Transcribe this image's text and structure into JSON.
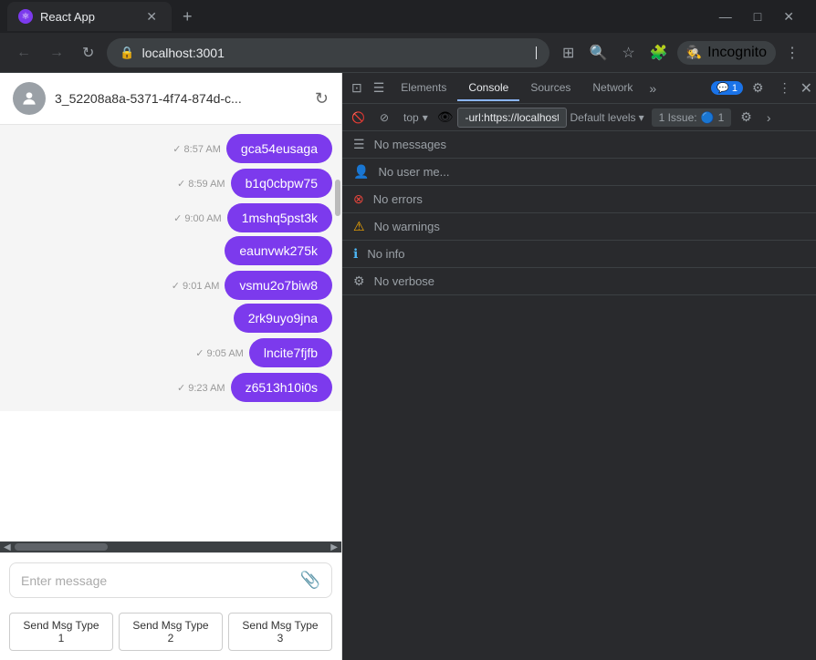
{
  "browser": {
    "tab_title": "React App",
    "address": "localhost:3001",
    "new_tab_icon": "+",
    "nav": {
      "back": "←",
      "forward": "→",
      "reload": "↻"
    },
    "window_controls": {
      "minimize": "—",
      "maximize": "□",
      "close": "✕"
    },
    "incognito_label": "Incognito"
  },
  "app": {
    "header_title": "3_52208a8a-5371-4f74-874d-c...",
    "messages": [
      {
        "time": "8:57 AM",
        "check": true,
        "bubbles": [
          "gca54eusaga"
        ]
      },
      {
        "time": "8:59 AM",
        "check": true,
        "bubbles": [
          "b1q0cbpw75"
        ]
      },
      {
        "time": "9:00 AM",
        "check": true,
        "bubbles": [
          "1mshq5pst3k",
          "eaunvwk275k"
        ]
      },
      {
        "time": "9:01 AM",
        "check": true,
        "bubbles": [
          "vsmu2o7biw8",
          "2rk9uyo9jna"
        ]
      },
      {
        "time": "9:05 AM",
        "check": true,
        "bubbles": [
          "lncite7fjfb"
        ]
      },
      {
        "time": "9:23 AM",
        "check": true,
        "bubbles": [
          "z6513h10i0s"
        ]
      }
    ],
    "input_placeholder": "Enter message",
    "action_buttons": [
      "Send Msg Type 1",
      "Send Msg Type 2",
      "Send Msg Type 3"
    ]
  },
  "devtools": {
    "tabs": [
      "Elements",
      "Console",
      "Sources",
      "Network"
    ],
    "active_tab": "Console",
    "tab_icons": [
      "⊡",
      "☰"
    ],
    "toolbar": {
      "clear_icon": "🚫",
      "context": "top",
      "eye_label": "👁",
      "filter_placeholder": "-url:https://localhost",
      "levels_label": "Default levels",
      "issue_count": "1 Issue: 🔵 1"
    },
    "console_items": [
      {
        "type": "msg",
        "icon": "☰",
        "text": "No messages"
      },
      {
        "type": "user",
        "icon": "👤",
        "text": "No user me..."
      },
      {
        "type": "error",
        "icon": "⊗",
        "text": "No errors"
      },
      {
        "type": "warning",
        "icon": "⚠",
        "text": "No warnings"
      },
      {
        "type": "info",
        "icon": "ℹ",
        "text": "No info"
      },
      {
        "type": "verbose",
        "icon": "⚙",
        "text": "No verbose"
      }
    ],
    "badge_count": "1",
    "chevron_icon": "›"
  }
}
